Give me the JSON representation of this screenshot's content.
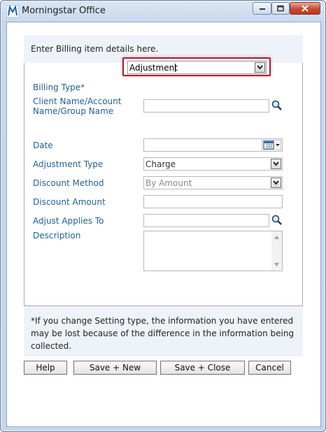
{
  "window": {
    "title": "Morningstar Office",
    "controls": {
      "minimize_icon": "minimize-icon",
      "maximize_icon": "maximize-icon",
      "close_icon": "close-icon"
    }
  },
  "header": {
    "text": "Enter Billing item details here."
  },
  "form": {
    "billing_type": {
      "label": "Billing Type*",
      "value": "Adjustment"
    },
    "client_name": {
      "label": "Client Name/Account Name/Group Name",
      "value": ""
    },
    "date": {
      "label": "Date",
      "value": ""
    },
    "adjustment_type": {
      "label": "Adjustment Type",
      "value": "Charge"
    },
    "discount_method": {
      "label": "Discount Method",
      "value": "By Amount"
    },
    "discount_amount": {
      "label": "Discount Amount",
      "value": ""
    },
    "adjust_applies_to": {
      "label": "Adjust Applies To",
      "value": ""
    },
    "description": {
      "label": "Description",
      "value": ""
    }
  },
  "note": {
    "text": "*If you change Setting type, the information you have entered may be lost because of the difference in the information being collected."
  },
  "buttons": {
    "help": "Help",
    "save_new": "Save + New",
    "save_close": "Save + Close",
    "cancel": "Cancel"
  },
  "colors": {
    "label": "#23609f",
    "highlight_border": "#b01c2e",
    "band": "#eef3f9"
  }
}
